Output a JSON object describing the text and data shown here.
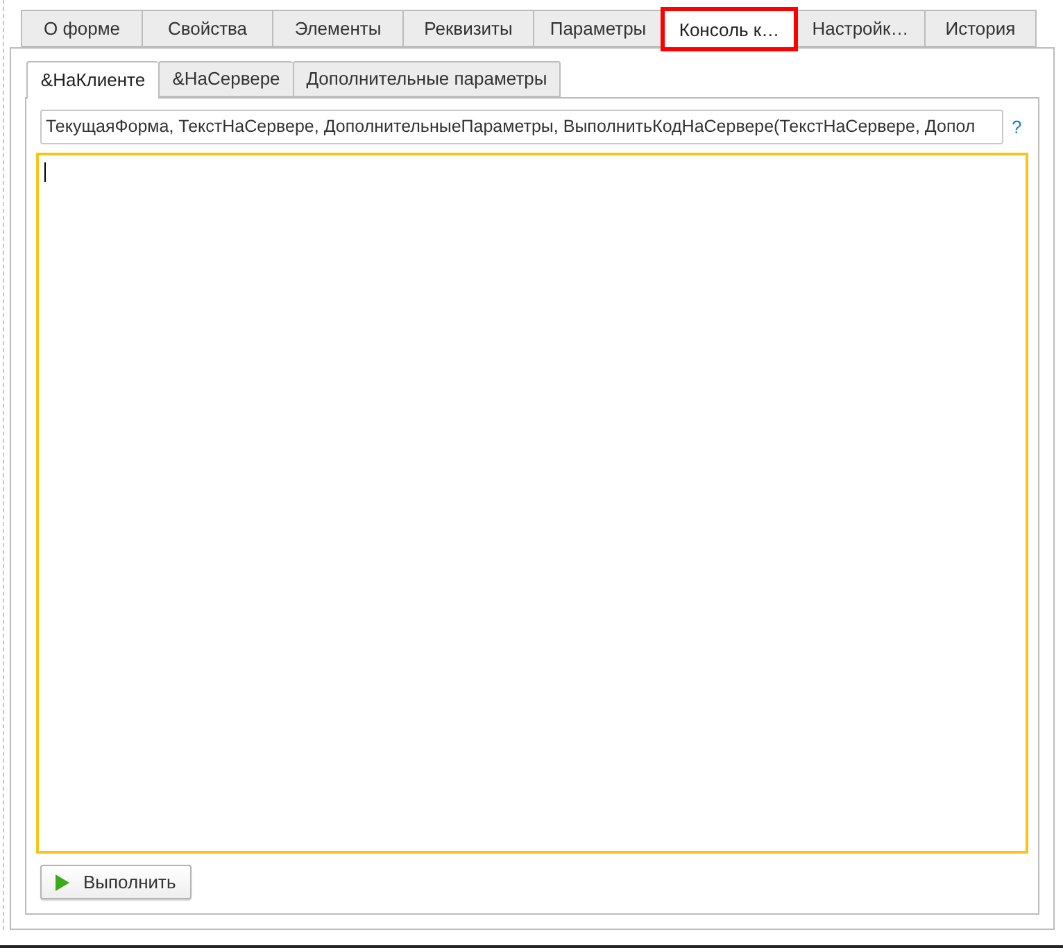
{
  "tabs": [
    {
      "label": "О форме",
      "selected": false,
      "highlighted": false
    },
    {
      "label": "Свойства",
      "selected": false,
      "highlighted": false
    },
    {
      "label": "Элементы",
      "selected": false,
      "highlighted": false
    },
    {
      "label": "Реквизиты",
      "selected": false,
      "highlighted": false
    },
    {
      "label": "Параметры",
      "selected": false,
      "highlighted": false
    },
    {
      "label": "Консоль к…",
      "selected": true,
      "highlighted": true
    },
    {
      "label": "Настройк…",
      "selected": false,
      "highlighted": false
    },
    {
      "label": "История",
      "selected": false,
      "highlighted": false
    }
  ],
  "subtabs": [
    {
      "label": "&НаКлиенте",
      "selected": true
    },
    {
      "label": "&НаСервере",
      "selected": false
    },
    {
      "label": "Дополнительные параметры",
      "selected": false
    }
  ],
  "parameters_field": {
    "value": "ТекущаяФорма, ТекстНаСервере, ДополнительныеПараметры, ВыполнитьКодНаСервере(ТекстНаСервере, Допол"
  },
  "help_link": {
    "label": "?"
  },
  "code_editor": {
    "focused": true
  },
  "run_button": {
    "label": "Выполнить"
  }
}
